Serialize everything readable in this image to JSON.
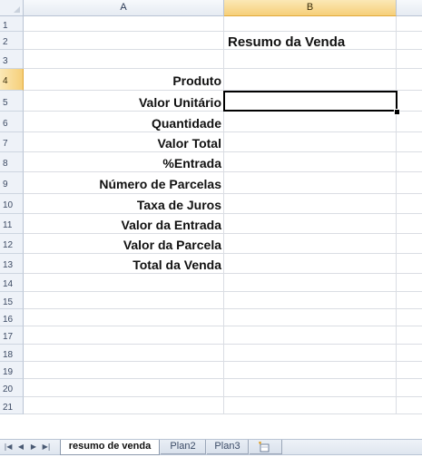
{
  "sheet": {
    "columns": [
      "A",
      "B"
    ],
    "selected_column": "B",
    "selected_row": "4",
    "rows": [
      {
        "num": "1",
        "a": "",
        "b": ""
      },
      {
        "num": "2",
        "a": "",
        "b": "Resumo da Venda"
      },
      {
        "num": "3",
        "a": "",
        "b": ""
      },
      {
        "num": "4",
        "a": "Produto",
        "b": ""
      },
      {
        "num": "5",
        "a": "Valor Unitário",
        "b": ""
      },
      {
        "num": "6",
        "a": "Quantidade",
        "b": ""
      },
      {
        "num": "7",
        "a": "Valor Total",
        "b": ""
      },
      {
        "num": "8",
        "a": "%Entrada",
        "b": ""
      },
      {
        "num": "9",
        "a": "Número de Parcelas",
        "b": ""
      },
      {
        "num": "10",
        "a": "Taxa de Juros",
        "b": ""
      },
      {
        "num": "11",
        "a": "Valor da Entrada",
        "b": ""
      },
      {
        "num": "12",
        "a": "Valor da Parcela",
        "b": ""
      },
      {
        "num": "13",
        "a": "Total da Venda",
        "b": ""
      },
      {
        "num": "14",
        "a": "",
        "b": ""
      },
      {
        "num": "15",
        "a": "",
        "b": ""
      },
      {
        "num": "16",
        "a": "",
        "b": ""
      },
      {
        "num": "17",
        "a": "",
        "b": ""
      },
      {
        "num": "18",
        "a": "",
        "b": ""
      },
      {
        "num": "19",
        "a": "",
        "b": ""
      },
      {
        "num": "20",
        "a": "",
        "b": ""
      },
      {
        "num": "21",
        "a": "",
        "b": ""
      }
    ]
  },
  "tabs": {
    "nav_first": "◀◀",
    "nav_prev": "◀",
    "nav_next": "▶",
    "nav_last": "▶▶",
    "items": [
      {
        "label": "resumo de venda",
        "active": true
      },
      {
        "label": "Plan2",
        "active": false
      },
      {
        "label": "Plan3",
        "active": false
      }
    ],
    "insert_sheet_icon": "insert-worksheet-icon"
  },
  "colors": {
    "selected_header": "#f6cf79",
    "grid_line": "#dadde3",
    "header_bg": "#eef2f8",
    "active_cell_border": "#000000"
  }
}
